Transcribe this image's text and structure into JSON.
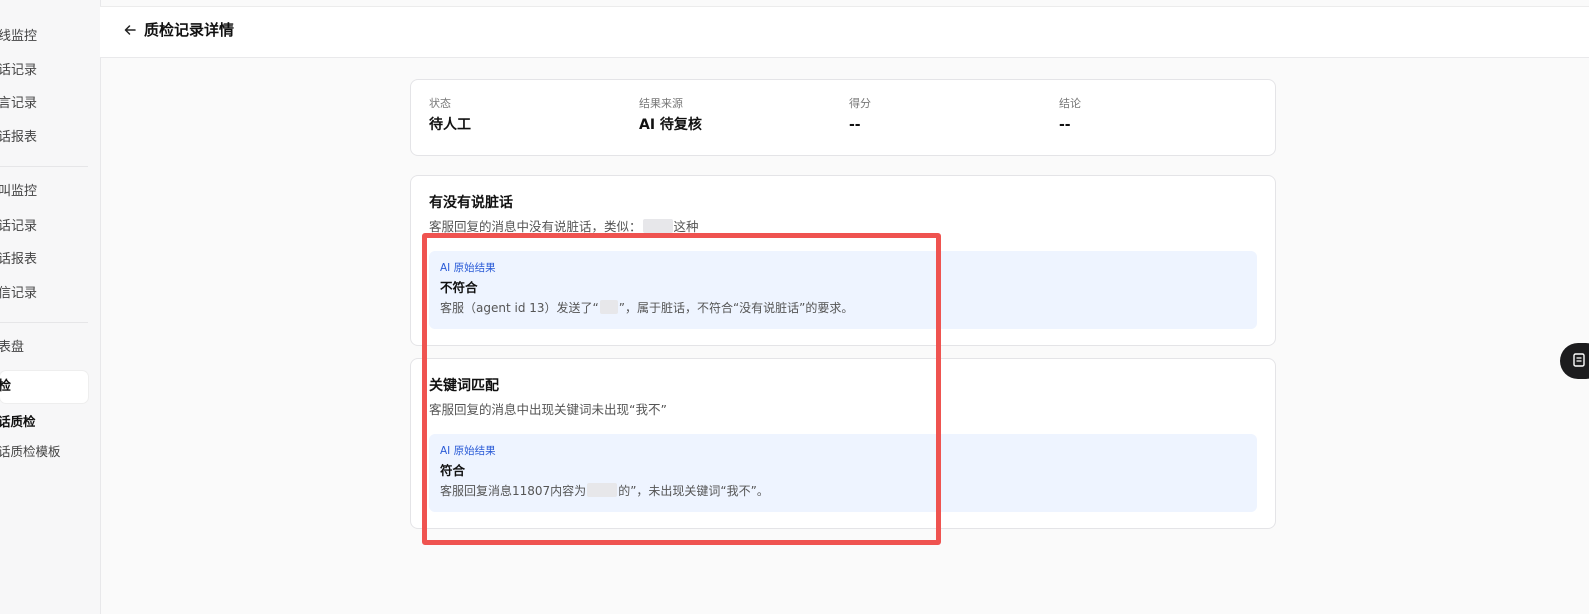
{
  "sidebar": {
    "items": [
      {
        "label": "线监控"
      },
      {
        "label": "话记录"
      },
      {
        "label": "言记录"
      },
      {
        "label": "话报表"
      },
      {
        "label": "叫监控"
      },
      {
        "label": "话记录"
      },
      {
        "label": "话报表"
      },
      {
        "label": "信记录"
      },
      {
        "label": "表盘"
      },
      {
        "label": "检"
      },
      {
        "label": "话质检"
      },
      {
        "label": "话质检模板"
      }
    ]
  },
  "header": {
    "title": "质检记录详情",
    "back_icon": "arrow-left-icon"
  },
  "summary": [
    {
      "label": "状态",
      "value": "待人工"
    },
    {
      "label": "结果来源",
      "value": "AI 待复核"
    },
    {
      "label": "得分",
      "value": "--"
    },
    {
      "label": "结论",
      "value": "--"
    }
  ],
  "rules": [
    {
      "title": "有没有说脏话",
      "desc_before": "客服回复的消息中没有说脏话，类似：",
      "desc_after": "这种",
      "ai_label": "AI 原始结果",
      "verdict": "不符合",
      "reason_before": "客服（agent id 13）发送了“",
      "reason_after": "”，属于脏话，不符合“没有说脏话”的要求。"
    },
    {
      "title": "关键词匹配",
      "desc": "客服回复的消息中出现关键词未出现“我不”",
      "ai_label": "AI 原始结果",
      "verdict": "符合",
      "reason_before": "客服回复消息11807内容为",
      "reason_after": "的”，未出现关键词“我不”。"
    }
  ],
  "float_button": {
    "icon": "book-icon"
  },
  "colors": {
    "highlight": "#ef5350",
    "ai_box_bg": "#eef4ff",
    "ai_label": "#2a5bd7",
    "float_button": "#1c1c1e"
  }
}
